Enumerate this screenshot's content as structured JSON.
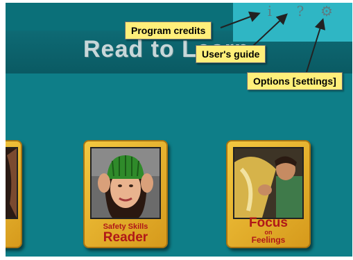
{
  "app": {
    "title": "Read to Learn"
  },
  "toolbar": {
    "credits_icon": "info-icon",
    "help_icon": "question-mark-icon",
    "options_icon": "gear-icon",
    "credits_glyph": "i",
    "help_glyph": "?",
    "options_glyph": "⚙"
  },
  "callouts": {
    "credits": "Program credits",
    "guide": "User's guide",
    "options": "Options [settings]"
  },
  "books": [
    {
      "line1": "Safety Skills",
      "line2": "Reader"
    },
    {
      "line1": "Focus",
      "line2": "on",
      "line3": "Feelings"
    }
  ],
  "colors": {
    "background": "#0e7e88",
    "toolbar": "#2fb6c4",
    "callout": "#ffef7a",
    "book_frame": "#e3b02b",
    "book_label": "#b01818"
  }
}
